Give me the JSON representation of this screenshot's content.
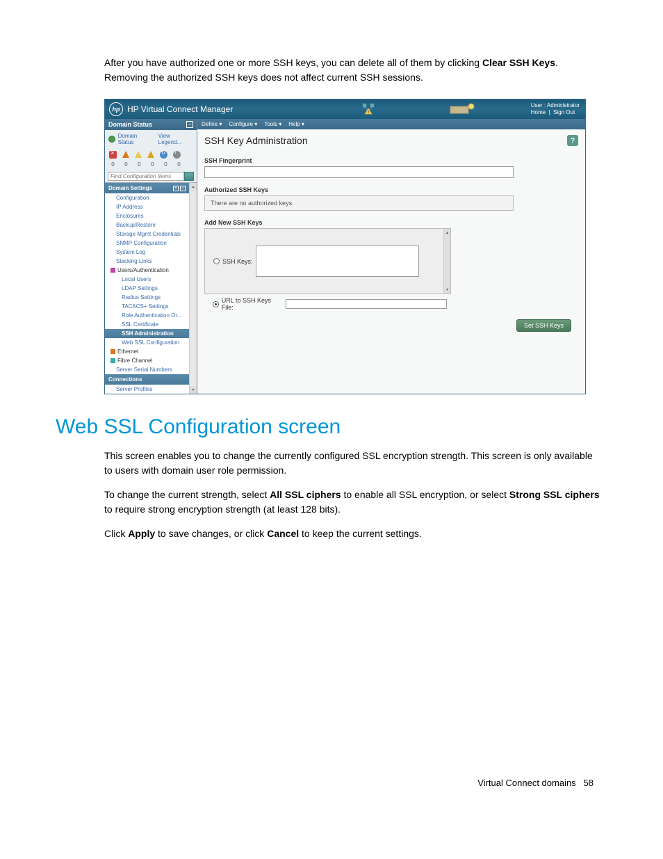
{
  "intro": {
    "line1a": "After you have authorized one or more SSH keys, you can delete all of them by clicking ",
    "line1b": "Clear SSH Keys",
    "line1c": ". Removing the authorized SSH keys does not affect current SSH sessions."
  },
  "app": {
    "title": "HP Virtual Connect Manager",
    "user_label": "User : Administrator",
    "home": "Home",
    "signout": "Sign Out",
    "menu": {
      "define": "Define ▾",
      "configure": "Configure ▾",
      "tools": "Tools ▾",
      "help": "Help ▾"
    },
    "left": {
      "domain_status_hdr": "Domain Status",
      "domain_status_link": "Domain Status",
      "view_legend": "View Legend...",
      "counts": [
        "0",
        "0",
        "0",
        "0",
        "0",
        "0"
      ],
      "find_placeholder": "Find Configuration Items",
      "domain_settings_hdr": "Domain Settings",
      "items": {
        "configuration": "Configuration",
        "ip_address": "IP Address",
        "enclosures": "Enclosures",
        "backup_restore": "Backup/Restore",
        "storage_mgmt": "Storage Mgmt Credentials",
        "snmp": "SNMP Configuration",
        "system_log": "System Log",
        "stacking_links": "Stacking Links",
        "users_auth": "Users/Authentication",
        "local_users": "Local Users",
        "ldap": "LDAP Settings",
        "radius": "Radius Settings",
        "tacacs": "TACACS+ Settings",
        "role_auth": "Role Authentication Or...",
        "ssl_cert": "SSL Certificate",
        "ssh_admin": "SSH Administration",
        "web_ssl": "Web SSL Configuration",
        "ethernet": "Ethernet",
        "fibre": "Fibre Channel",
        "server_serial": "Server Serial Numbers",
        "connections_hdr": "Connections",
        "server_profiles": "Server Profiles"
      }
    },
    "main": {
      "page_title": "SSH Key Administration",
      "ssh_fingerprint": "SSH Fingerprint",
      "authorized_keys": "Authorized SSH Keys",
      "no_keys_msg": "There are no authorized keys.",
      "add_new": "Add New SSH Keys",
      "ssh_keys_radio": "SSH Keys:",
      "url_radio": "URL to SSH Keys File:",
      "set_btn": "Set SSH Keys"
    }
  },
  "heading": "Web SSL Configuration screen",
  "para1": "This screen enables you to change the currently configured SSL encryption strength. This screen is only available to users with domain user role permission.",
  "para2": {
    "a": "To change the current strength, select ",
    "b": "All SSL ciphers",
    "c": " to enable all SSL encryption, or select ",
    "d": "Strong SSL ciphers",
    "e": " to require strong encryption strength (at least 128 bits)."
  },
  "para3": {
    "a": "Click ",
    "b": "Apply",
    "c": " to save changes, or click ",
    "d": "Cancel",
    "e": " to keep the current settings."
  },
  "footer": {
    "label": "Virtual Connect domains",
    "page": "58"
  }
}
